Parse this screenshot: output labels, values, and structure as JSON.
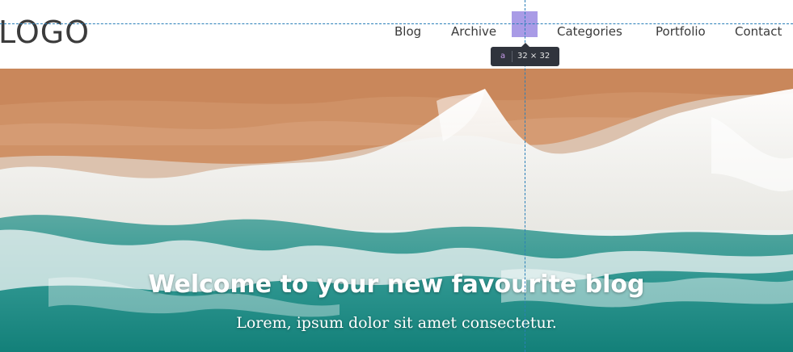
{
  "header": {
    "logo": "LOGO",
    "nav": [
      {
        "label": "Blog"
      },
      {
        "label": "Archive"
      },
      {
        "label": "Categories"
      },
      {
        "label": "Portfolio"
      },
      {
        "label": "Contact"
      }
    ]
  },
  "devtools": {
    "tag": "a",
    "size": "32 × 32"
  },
  "hero": {
    "title": "Welcome to your new favourite blog",
    "subtitle": "Lorem, ipsum dolor sit amet consectetur."
  }
}
